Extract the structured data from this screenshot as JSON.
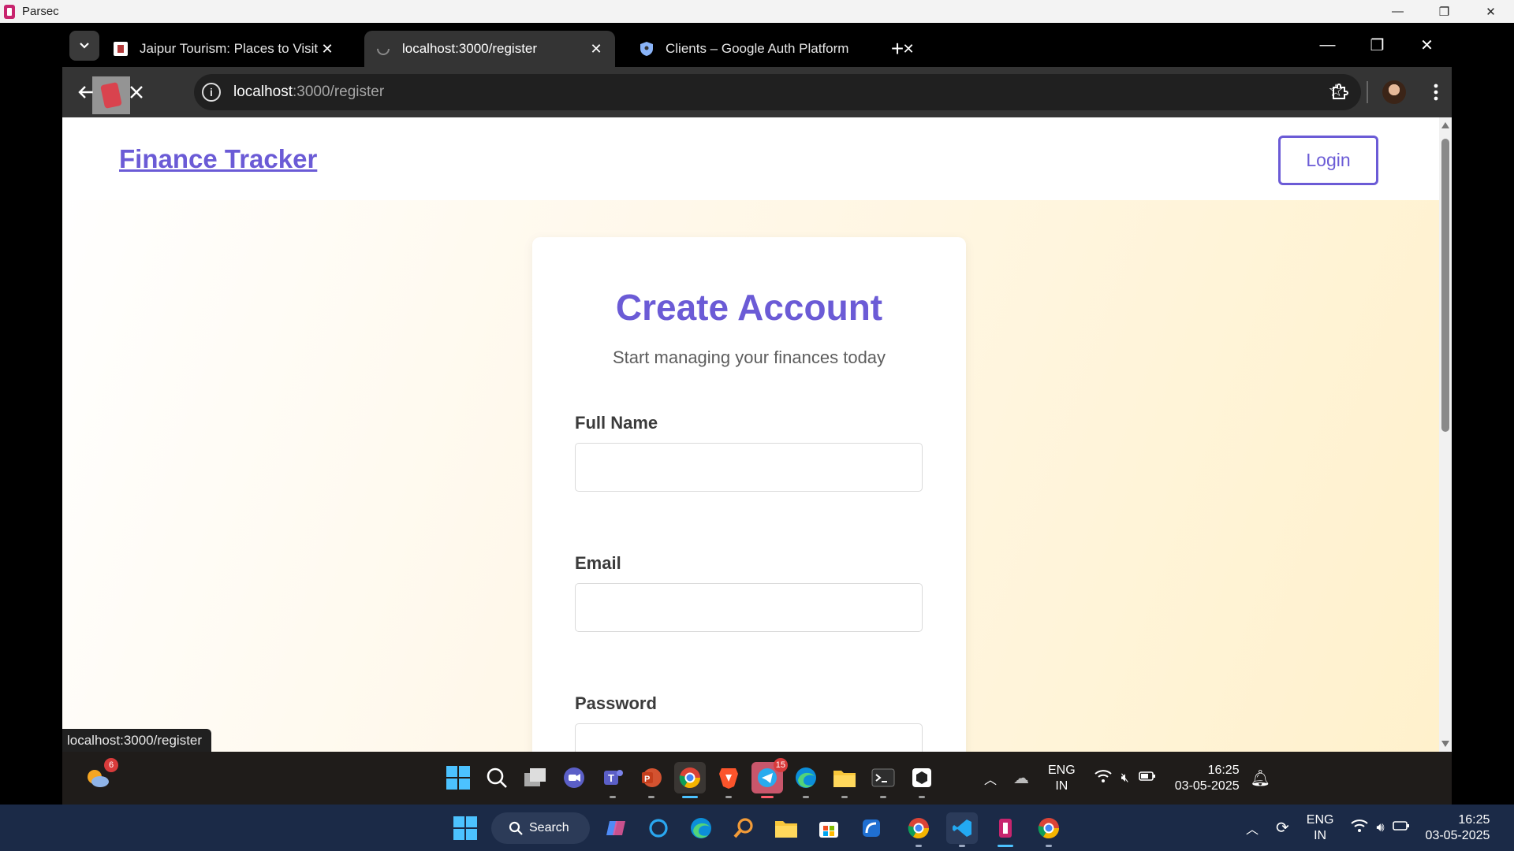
{
  "parsec": {
    "title": "Parsec",
    "controls": [
      "—",
      "❐",
      "✕"
    ]
  },
  "browser": {
    "tabs": [
      {
        "title": "Jaipur Tourism: Places to Visit, S",
        "active": false
      },
      {
        "title": "localhost:3000/register",
        "active": true
      },
      {
        "title": "Clients – Google Auth Platform",
        "active": false
      }
    ],
    "new_tab": "+",
    "url_host": "localhost",
    "url_path": ":3000/register",
    "status_url": "localhost:3000/register"
  },
  "page": {
    "brand": "Finance Tracker",
    "login_label": "Login",
    "card_title": "Create Account",
    "card_subtitle": "Start managing your finances today",
    "fields": [
      {
        "label": "Full Name",
        "value": ""
      },
      {
        "label": "Email",
        "value": ""
      },
      {
        "label": "Password",
        "value": ""
      }
    ]
  },
  "remote_taskbar": {
    "weather_badge": "6",
    "telegram_badge": "15",
    "lang_top": "ENG",
    "lang_bottom": "IN",
    "time": "16:25",
    "date": "03-05-2025"
  },
  "local_taskbar": {
    "search_label": "Search",
    "lang_top": "ENG",
    "lang_bottom": "IN",
    "time": "16:25",
    "date": "03-05-2025"
  },
  "colors": {
    "accent": "#6b5bd6",
    "remote_taskbar": "#1f1c1a",
    "local_taskbar": "#1b2a47"
  }
}
